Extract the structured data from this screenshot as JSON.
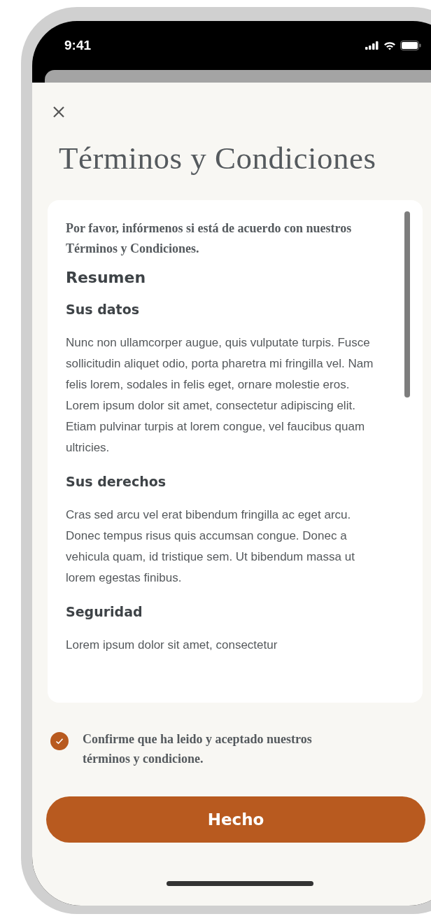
{
  "status_bar": {
    "time": "9:41"
  },
  "sheet": {
    "title": "Términos y Condiciones",
    "intro": "Por favor, infórmenos si está de acuerdo con nuestros Términos y Condiciones.",
    "blocks": [
      {
        "kind": "heading",
        "text": "Resumen"
      },
      {
        "kind": "subheading",
        "text": "Sus datos"
      },
      {
        "kind": "paragraph",
        "lines": [
          "Nunc non ullamcorper augue, quis vulputate turpis.  Fusce sollicitudin aliquet odio, porta pharetra mi fringilla vel. Nam felis lorem, sodales in felis eget, ornare molestie eros.",
          "Lorem ipsum dolor sit amet, consectetur adipiscing elit. Etiam pulvinar turpis at lorem congue, vel faucibus quam ultricies."
        ]
      },
      {
        "kind": "subheading",
        "text": "Sus derechos"
      },
      {
        "kind": "paragraph",
        "lines": [
          "Cras sed arcu vel erat bibendum fringilla ac eget arcu. Donec tempus risus quis accumsan congue. Donec a vehicula quam, id tristique sem. Ut bibendum massa ut lorem egestas finibus."
        ]
      },
      {
        "kind": "subheading",
        "text": "Seguridad"
      },
      {
        "kind": "paragraph",
        "lines": [
          "Lorem ipsum dolor sit amet, consectetur"
        ]
      }
    ],
    "consent": {
      "label": "Confirme que ha leido y aceptado nuestros términos y condicione.",
      "checked": true
    },
    "button": "Hecho"
  }
}
